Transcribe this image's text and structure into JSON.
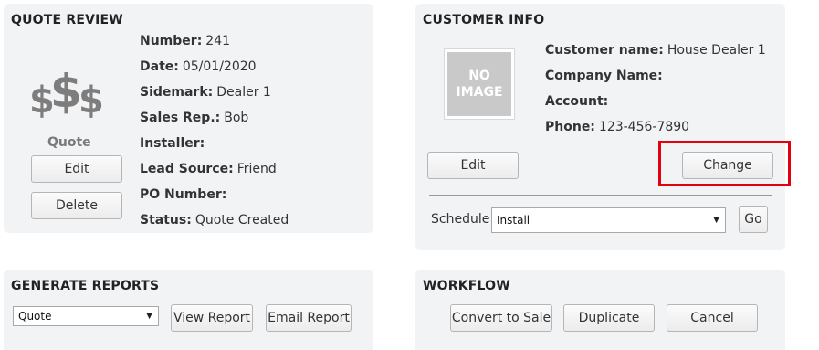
{
  "quote_review": {
    "title": "QUOTE REVIEW",
    "icon": "dollar-signs-icon",
    "icon_text": "$$$",
    "type_label": "Quote",
    "edit_label": "Edit",
    "delete_label": "Delete",
    "fields": [
      {
        "label": "Number:",
        "value": "241"
      },
      {
        "label": "Date:",
        "value": "05/01/2020"
      },
      {
        "label": "Sidemark:",
        "value": "Dealer 1"
      },
      {
        "label": "Sales Rep.:",
        "value": "Bob"
      },
      {
        "label": "Installer:",
        "value": ""
      },
      {
        "label": "Lead Source:",
        "value": "Friend"
      },
      {
        "label": "PO Number:",
        "value": ""
      },
      {
        "label": "Status:",
        "value": "Quote Created"
      }
    ]
  },
  "customer_info": {
    "title": "CUSTOMER INFO",
    "image_line1": "NO",
    "image_line2": "IMAGE",
    "fields": [
      {
        "label": "Customer name:",
        "value": "House Dealer 1"
      },
      {
        "label": "Company Name:",
        "value": ""
      },
      {
        "label": "Account:",
        "value": ""
      },
      {
        "label": "Phone:",
        "value": "123-456-7890"
      }
    ],
    "edit_label": "Edit",
    "change_label": "Change",
    "schedule_label": "Schedule:",
    "schedule_value": "Install",
    "go_label": "Go",
    "highlight_color": "#e3000f"
  },
  "generate_reports": {
    "title": "GENERATE REPORTS",
    "report_select_value": "Quote",
    "view_label": "View Report",
    "email_label": "Email Report"
  },
  "workflow": {
    "title": "WORKFLOW",
    "convert_label": "Convert to Sale",
    "duplicate_label": "Duplicate",
    "cancel_label": "Cancel"
  }
}
